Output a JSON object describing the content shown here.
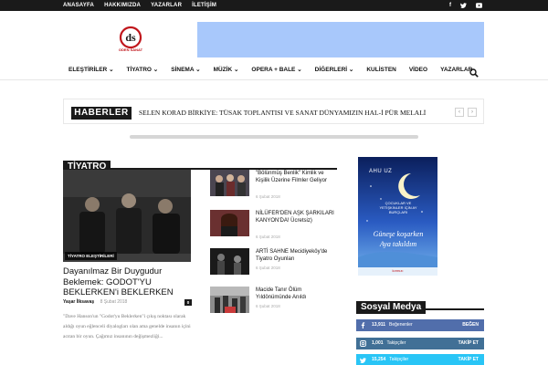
{
  "topbar": {
    "nav": [
      "ANASAYFA",
      "HAKKIMIZDA",
      "YAZARLAR",
      "İLETİŞİM"
    ],
    "social_icons": [
      "facebook-icon",
      "twitter-icon",
      "youtube-icon"
    ]
  },
  "header": {
    "logo_text": "ODEN SANAT",
    "logo_color": "#c0151b",
    "banner_color": "#a8c8fb"
  },
  "menu": {
    "items": [
      "ELEŞTİRİLER",
      "TİYATRO",
      "SİNEMA",
      "MÜZİK",
      "OPERA + BALE",
      "DİĞERLERİ",
      "KULİSTEN",
      "VİDEO",
      "YAZARLAR"
    ],
    "dropdowns": [
      "ELEŞTİRİLER",
      "TİYATRO",
      "SİNEMA",
      "MÜZİK",
      "OPERA + BALE",
      "DİĞERLERİ"
    ]
  },
  "ticker": {
    "label": "HABERLER",
    "text": "SELEN KORAD BİRKİYE: TÜSAK TOPLANTISI VE SANAT DÜNYAMIZIN HAL-İ PÜR MELALİ",
    "prev": "‹",
    "next": "›"
  },
  "section": {
    "label": "TİYATRO",
    "feature": {
      "category": "TİYATRO ELEŞTİRİLERİ",
      "title": "Dayanılmaz Bir Duygudur Beklemek: GODOT'YU BEKLERKEN'i BEKLERKEN",
      "author": "Yaşar İlksavaş",
      "date": "8 Şubat 2018",
      "comments": "0",
      "excerpt": "\"Dave Hanson'un \"Godot'yu Beklerken\"i çıkış noktası olarak aldığı oyun eğlenceli diyalogları olan ama genelde insanın içini acıtan bir oyun. Çağımız insanının değişmezliği..."
    },
    "items": [
      {
        "title": "\"Bölünmüş Benlik\" Kimlik ve Kişilik Üzerine Filmler Geliyor",
        "date": "6 Şubat 2018"
      },
      {
        "title": "NİLÜFER'DEN AŞK ŞARKILARI KANYON'DA! Ücretsiz)",
        "date": "6 Şubat 2018"
      },
      {
        "title": "ARTİ SAHNE Mecidiyeköy'de Tiyatro Oyunları",
        "date": "6 Şubat 2018"
      },
      {
        "title": "Macide Tanır Ölüm Yıldönümünde Anıldı",
        "date": "6 Şubat 2018"
      }
    ]
  },
  "ad_book": {
    "author": "AHU UZ",
    "subtitle": "ÇOCUKLAR VE YETİŞKİNLER İÇİN AY BURÇLARI",
    "title_line1": "Güneşe koşarken",
    "title_line2": "Aya takıldım",
    "publisher": "kırmızı"
  },
  "social": {
    "label": "Sosyal Medya",
    "rows": [
      {
        "icon": "facebook-icon",
        "count": "13,911",
        "label": "Beğenenler",
        "action": "BEĞEN",
        "color": "#516eab"
      },
      {
        "icon": "instagram-icon",
        "count": "1,001",
        "label": "Takipçiler",
        "action": "TAKİP ET",
        "color": "#417096"
      },
      {
        "icon": "twitter-icon",
        "count": "15,254",
        "label": "Takipçiler",
        "action": "TAKİP ET",
        "color": "#29c5f6"
      }
    ]
  }
}
